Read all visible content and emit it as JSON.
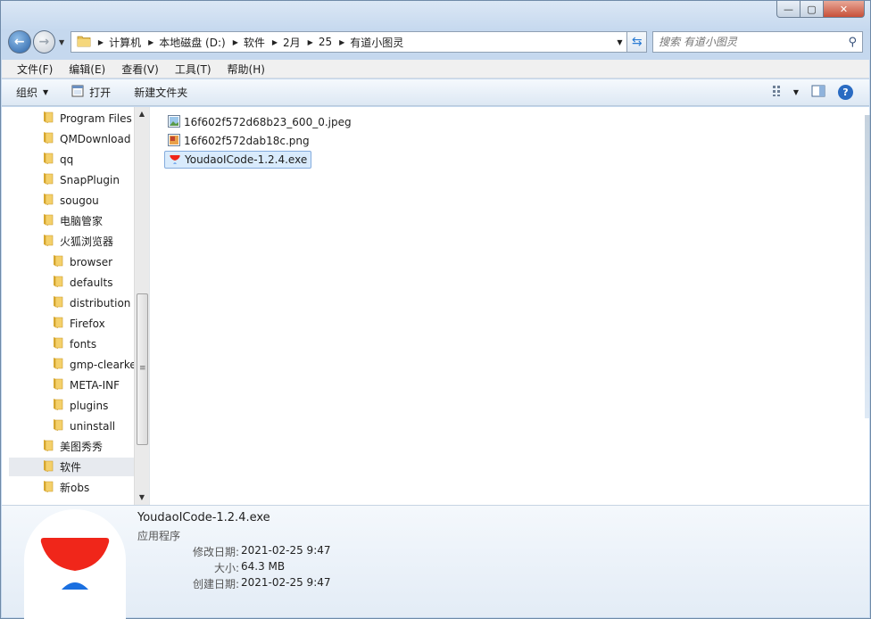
{
  "window": {
    "minimize_label": "—",
    "maximize_label": "▢",
    "close_label": "✕"
  },
  "address": {
    "crumbs": [
      "计算机",
      "本地磁盘 (D:)",
      "软件",
      "2月",
      "25",
      "有道小图灵"
    ]
  },
  "search": {
    "placeholder": "搜索 有道小图灵"
  },
  "menubar": {
    "items": [
      "文件(F)",
      "编辑(E)",
      "查看(V)",
      "工具(T)",
      "帮助(H)"
    ]
  },
  "toolbar": {
    "organize_label": "组织",
    "open_label": "打开",
    "new_folder_label": "新建文件夹"
  },
  "tree": {
    "items": [
      {
        "label": "Program Files",
        "level": 0
      },
      {
        "label": "QMDownload",
        "level": 0
      },
      {
        "label": "qq",
        "level": 0
      },
      {
        "label": "SnapPlugin",
        "level": 0
      },
      {
        "label": "sougou",
        "level": 0
      },
      {
        "label": "电脑管家",
        "level": 0
      },
      {
        "label": "火狐浏览器",
        "level": 0
      },
      {
        "label": "browser",
        "level": 1
      },
      {
        "label": "defaults",
        "level": 1
      },
      {
        "label": "distribution",
        "level": 1
      },
      {
        "label": "Firefox",
        "level": 1
      },
      {
        "label": "fonts",
        "level": 1
      },
      {
        "label": "gmp-clearkey",
        "level": 1
      },
      {
        "label": "META-INF",
        "level": 1
      },
      {
        "label": "plugins",
        "level": 1
      },
      {
        "label": "uninstall",
        "level": 1
      },
      {
        "label": "美图秀秀",
        "level": 0
      },
      {
        "label": "软件",
        "level": 0,
        "selected": true
      },
      {
        "label": "新obs",
        "level": 0
      }
    ]
  },
  "files": [
    {
      "name": "16f602f572d68b23_600_0.jpeg",
      "icon": "jpeg-image-icon"
    },
    {
      "name": "16f602f572dab18c.png",
      "icon": "png-image-icon"
    },
    {
      "name": "YoudaoICode-1.2.4.exe",
      "icon": "youdao-app-icon",
      "selected": true
    }
  ],
  "details": {
    "name": "YoudaoICode-1.2.4.exe",
    "type": "应用程序",
    "modified_label": "修改日期:",
    "modified_value": "2021-02-25 9:47",
    "size_label": "大小:",
    "size_value": "64.3 MB",
    "created_label": "创建日期:",
    "created_value": "2021-02-25 9:47"
  },
  "colors": {
    "accent": "#2a63a8",
    "selection": "#d9ebfc",
    "youdao_red": "#f0261a",
    "youdao_blue": "#1a6fe0"
  }
}
